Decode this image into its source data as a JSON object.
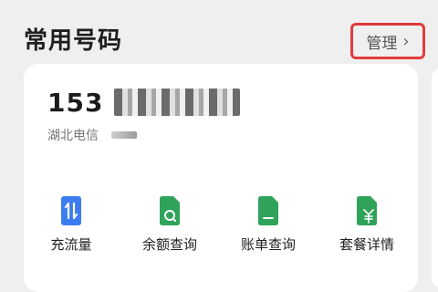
{
  "header": {
    "title": "常用号码",
    "manage_label": "管理",
    "manage_chevron": "›"
  },
  "card": {
    "number_prefix": "153",
    "carrier": "湖北电信"
  },
  "actions": [
    {
      "label": "充流量",
      "icon": "data-transfer-icon",
      "color": "#3b7cf0"
    },
    {
      "label": "余额查询",
      "icon": "balance-search-icon",
      "color": "#2fa35a"
    },
    {
      "label": "账单查询",
      "icon": "bill-document-icon",
      "color": "#2fa35a"
    },
    {
      "label": "套餐详情",
      "icon": "plan-yuan-icon",
      "color": "#2fa35a"
    }
  ]
}
